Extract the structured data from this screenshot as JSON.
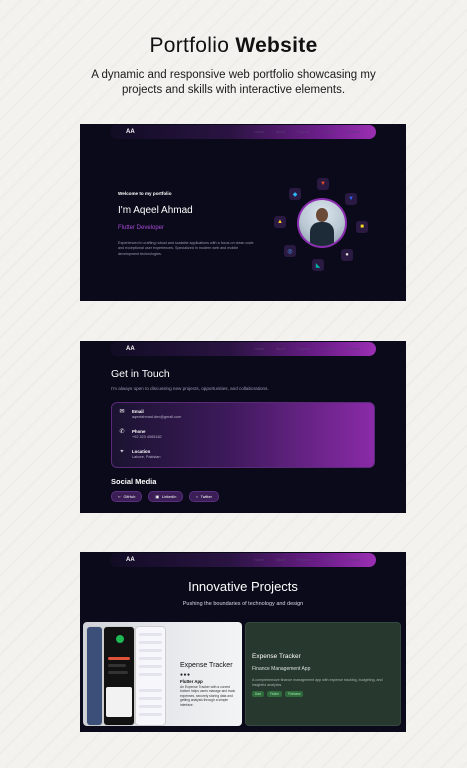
{
  "header": {
    "title_light": "Portfolio",
    "title_bold": "Website",
    "subtitle": "A dynamic and responsive web portfolio showcasing my projects and skills with interactive elements."
  },
  "nav": {
    "logo": "AA",
    "links": [
      "Home",
      "About",
      "Projects",
      "Contact",
      "Resume"
    ]
  },
  "hero": {
    "welcome": "Welcome to my portfolio",
    "name": "I'm Aqeel Ahmad",
    "role": "Flutter Developer",
    "description": "Experienced in crafting robust and scalable applications with a focus on clean code and exceptional user experiences. Specialized in modern web and mobile development technologies.",
    "tech_icons": [
      "flutter-icon",
      "html5-icon",
      "css3-icon",
      "javascript-icon",
      "github-icon",
      "dart-icon",
      "firebase-icon",
      "react-icon"
    ]
  },
  "contact": {
    "title": "Get in Touch",
    "lead": "I'm always open to discussing new projects, opportunities, and collaborations.",
    "items": [
      {
        "icon": "email-icon",
        "label": "Email",
        "value": "aqeelahmad.dev@gmail.com"
      },
      {
        "icon": "phone-icon",
        "label": "Phone",
        "value": "+92 323 4065182"
      },
      {
        "icon": "location-icon",
        "label": "Location",
        "value": "Lahore, Pakistan"
      }
    ],
    "social_title": "Social Media",
    "social": [
      {
        "icon": "code-icon",
        "label": "GitHub"
      },
      {
        "icon": "briefcase-icon",
        "label": "LinkedIn"
      },
      {
        "icon": "chat-icon",
        "label": "Twitter"
      }
    ]
  },
  "projects": {
    "title": "Innovative Projects",
    "lead": "Pushing the boundaries of technology and design",
    "preview": {
      "title": "Expense Tracker",
      "dots": "●●●",
      "subtitle": "Flutter App",
      "description": "An Expense Tracker with a curved bottom helps users manage and track expenses, securely storing data and getting analysis through a simple interface."
    },
    "card": {
      "title": "Expense Tracker",
      "subtitle": "Finance Management App",
      "description": "A comprehensive finance management app with expense tracking, budgeting, and insightful analytics.",
      "tags": [
        "Dart",
        "Flutter",
        "Firebase"
      ]
    }
  },
  "colors": {
    "accent": "#a54bd6",
    "panel_bg": "#0b0a1a",
    "card_green": "#27382f"
  }
}
